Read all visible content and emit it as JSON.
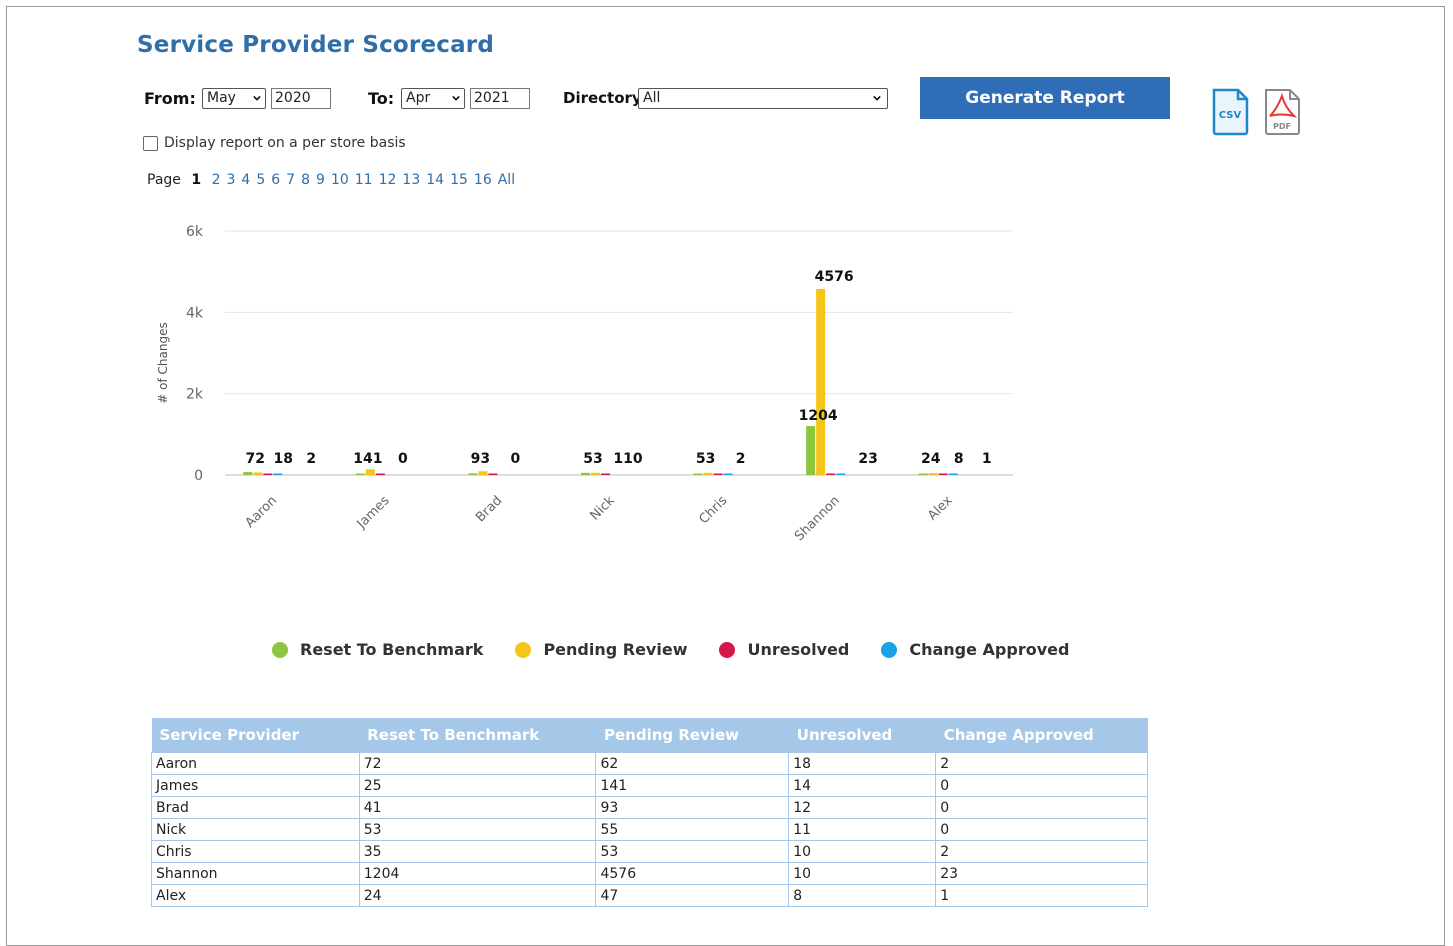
{
  "title": "Service Provider Scorecard",
  "filters": {
    "from_label": "From:",
    "from_month": "May",
    "from_year": "2020",
    "to_label": "To:",
    "to_month": "Apr",
    "to_year": "2021",
    "directory_label": "Directory",
    "directory_value": "All"
  },
  "generate_button": "Generate Report",
  "export": {
    "csv_label": "CSV",
    "pdf_label": "PDF"
  },
  "per_store_checkbox": {
    "label": "Display report on a per store basis",
    "checked": false
  },
  "pagination": {
    "label": "Page",
    "current": "1",
    "pages": [
      "2",
      "3",
      "4",
      "5",
      "6",
      "7",
      "8",
      "9",
      "10",
      "11",
      "12",
      "13",
      "14",
      "15",
      "16",
      "All"
    ]
  },
  "colors": {
    "reset": "#8cc63f",
    "pending": "#f5c518",
    "unresolved": "#d6174c",
    "approved": "#1aa3e8",
    "accent": "#2f6db6"
  },
  "chart_data": {
    "type": "bar",
    "title": "",
    "xlabel": "",
    "ylabel": "# of Changes",
    "ylim": [
      0,
      6000
    ],
    "yticks": [
      "0",
      "2k",
      "4k",
      "6k"
    ],
    "grid": true,
    "legend": "bottom",
    "categories": [
      "Aaron",
      "James",
      "Brad",
      "Nick",
      "Chris",
      "Shannon",
      "Alex"
    ],
    "series": [
      {
        "name": "Reset To Benchmark",
        "values": [
          72,
          25,
          41,
          53,
          35,
          1204,
          24
        ]
      },
      {
        "name": "Pending Review",
        "values": [
          62,
          141,
          93,
          55,
          53,
          4576,
          47
        ]
      },
      {
        "name": "Unresolved",
        "values": [
          18,
          14,
          12,
          11,
          10,
          10,
          8
        ]
      },
      {
        "name": "Change Approved",
        "values": [
          2,
          0,
          0,
          0,
          2,
          23,
          1
        ]
      }
    ],
    "data_labels": [
      [
        "72",
        "18",
        "2"
      ],
      [
        "141",
        "0"
      ],
      [
        "93",
        "0"
      ],
      [
        "53",
        "110"
      ],
      [
        "53",
        "2"
      ],
      [
        "1204",
        "4576",
        "23"
      ],
      [
        "24",
        "8",
        "1"
      ]
    ]
  },
  "legend": [
    {
      "label": "Reset To Benchmark"
    },
    {
      "label": "Pending Review"
    },
    {
      "label": "Unresolved"
    },
    {
      "label": "Change Approved"
    }
  ],
  "table": {
    "headers": [
      "Service Provider",
      "Reset To Benchmark",
      "Pending Review",
      "Unresolved",
      "Change Approved"
    ],
    "rows": [
      [
        "Aaron",
        "72",
        "62",
        "18",
        "2"
      ],
      [
        "James",
        "25",
        "141",
        "14",
        "0"
      ],
      [
        "Brad",
        "41",
        "93",
        "12",
        "0"
      ],
      [
        "Nick",
        "53",
        "55",
        "11",
        "0"
      ],
      [
        "Chris",
        "35",
        "53",
        "10",
        "2"
      ],
      [
        "Shannon",
        "1204",
        "4576",
        "10",
        "23"
      ],
      [
        "Alex",
        "24",
        "47",
        "8",
        "1"
      ]
    ]
  }
}
